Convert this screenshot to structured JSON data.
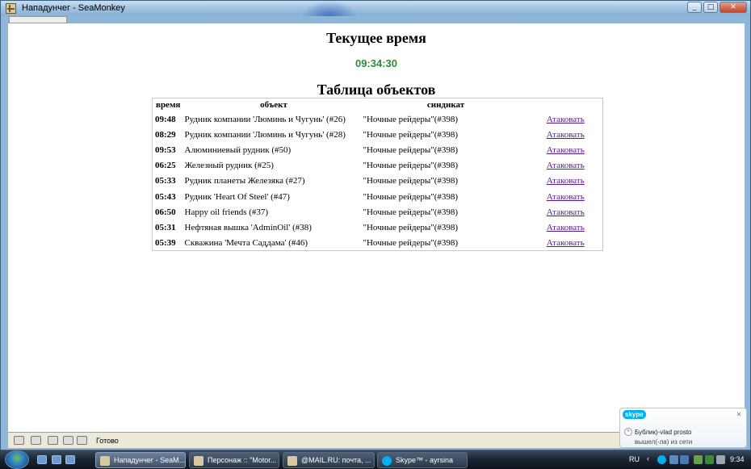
{
  "window": {
    "title": "Нападунчег - SeaMonkey"
  },
  "page": {
    "heading_time": "Текущее время",
    "clock": "09:34:30",
    "heading_table": "Таблица объектов",
    "columns": {
      "time": "время",
      "object": "объект",
      "syndicate": "синдикат"
    },
    "rows": [
      {
        "time": "09:48",
        "object": "Рудник компании 'Люминь и Чугунь' (#26)",
        "syndicate": "\"Ночные рейдеры\"(#398)",
        "action": "Атаковать"
      },
      {
        "time": "08:29",
        "object": "Рудник компании 'Люминь и Чугунь' (#28)",
        "syndicate": "\"Ночные рейдеры\"(#398)",
        "action": "Атаковать"
      },
      {
        "time": "09:53",
        "object": "Алюминиевый рудник (#50)",
        "syndicate": "\"Ночные рейдеры\"(#398)",
        "action": "Атаковать"
      },
      {
        "time": "06:25",
        "object": "Железный рудник (#25)",
        "syndicate": "\"Ночные рейдеры\"(#398)",
        "action": "Атаковать"
      },
      {
        "time": "05:33",
        "object": "Рудник планеты Железяка (#27)",
        "syndicate": "\"Ночные рейдеры\"(#398)",
        "action": "Атаковать"
      },
      {
        "time": "05:43",
        "object": "Рудник 'Heart Of Steel' (#47)",
        "syndicate": "\"Ночные рейдеры\"(#398)",
        "action": "Атаковать"
      },
      {
        "time": "06:50",
        "object": "Happy oil friends (#37)",
        "syndicate": "\"Ночные рейдеры\"(#398)",
        "action": "Атаковать"
      },
      {
        "time": "05:31",
        "object": "Нефтяная вышка 'AdminOil' (#38)",
        "syndicate": "\"Ночные рейдеры\"(#398)",
        "action": "Атаковать"
      },
      {
        "time": "05:39",
        "object": "Скважина 'Мечта Саддама' (#46)",
        "syndicate": "\"Ночные рейдеры\"(#398)",
        "action": "Атаковать"
      }
    ]
  },
  "statusbar": {
    "text": "Готово"
  },
  "taskbar": {
    "tasks": [
      {
        "label": "Нападунчег - SeaM...",
        "active": true
      },
      {
        "label": "Персонаж :: \"Motor...",
        "active": false
      },
      {
        "label": "@MAIL.RU: почта, ...",
        "active": false
      },
      {
        "label": "Skype™ - ayrsina",
        "active": false
      }
    ],
    "language": "RU",
    "clock": "9:34"
  },
  "skype_popup": {
    "logo": "skype",
    "line1": "Бублик)-vlad prosto",
    "line2": "вышел(-ла) из сети"
  },
  "colors": {
    "clock_green": "#2e8b3a",
    "link_purple": "#551a8b",
    "skype_blue": "#00aff0"
  }
}
